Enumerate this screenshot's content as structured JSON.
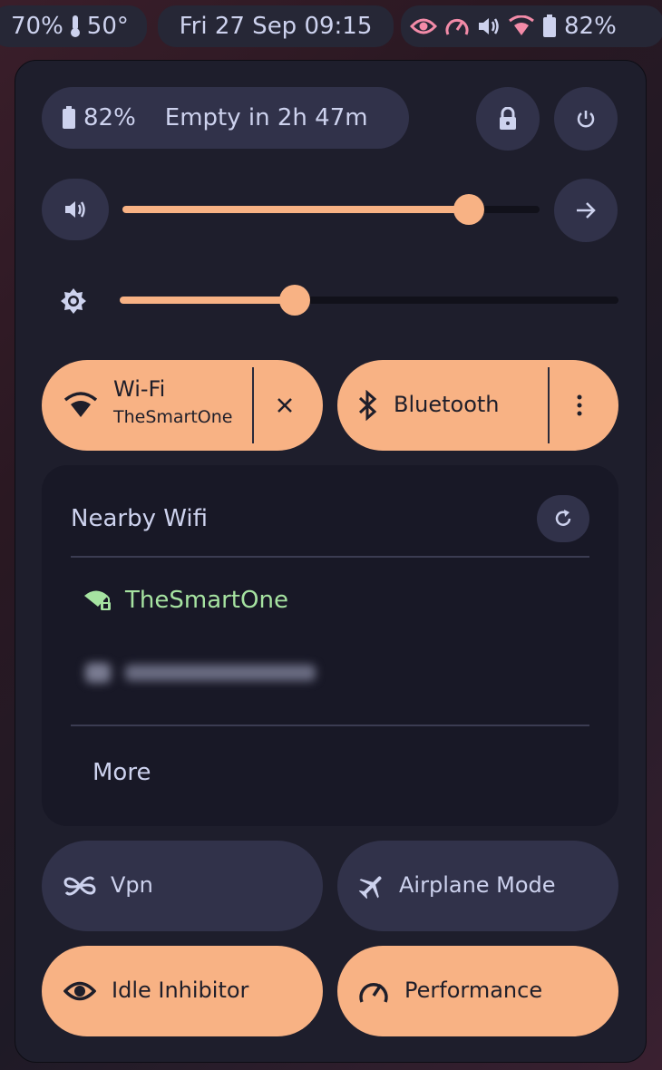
{
  "top_bar": {
    "cpu_percent": "70%",
    "temperature": "50°",
    "clock": "Fri 27 Sep 09:15",
    "battery_percent": "82%"
  },
  "battery": {
    "percent": "82%",
    "estimate": "Empty in 2h 47m"
  },
  "volume": {
    "level": 0.83
  },
  "brightness": {
    "level": 0.35
  },
  "toggles": {
    "wifi": {
      "label": "Wi-Fi",
      "network": "TheSmartOne"
    },
    "bluetooth": {
      "label": "Bluetooth"
    },
    "vpn": {
      "label": "Vpn"
    },
    "airplane": {
      "label": "Airplane Mode"
    },
    "idle": {
      "label": "Idle Inhibitor"
    },
    "performance": {
      "label": "Performance"
    }
  },
  "wifi_list": {
    "title": "Nearby Wifi",
    "networks": [
      {
        "name": "TheSmartOne",
        "connected": true
      }
    ],
    "more_label": "More"
  },
  "colors": {
    "accent": "#f8b284",
    "connected": "#a6e3a1",
    "status_icon": "#f38ba8",
    "panel_bg": "#1e1e2c",
    "button_bg": "#31324a"
  }
}
